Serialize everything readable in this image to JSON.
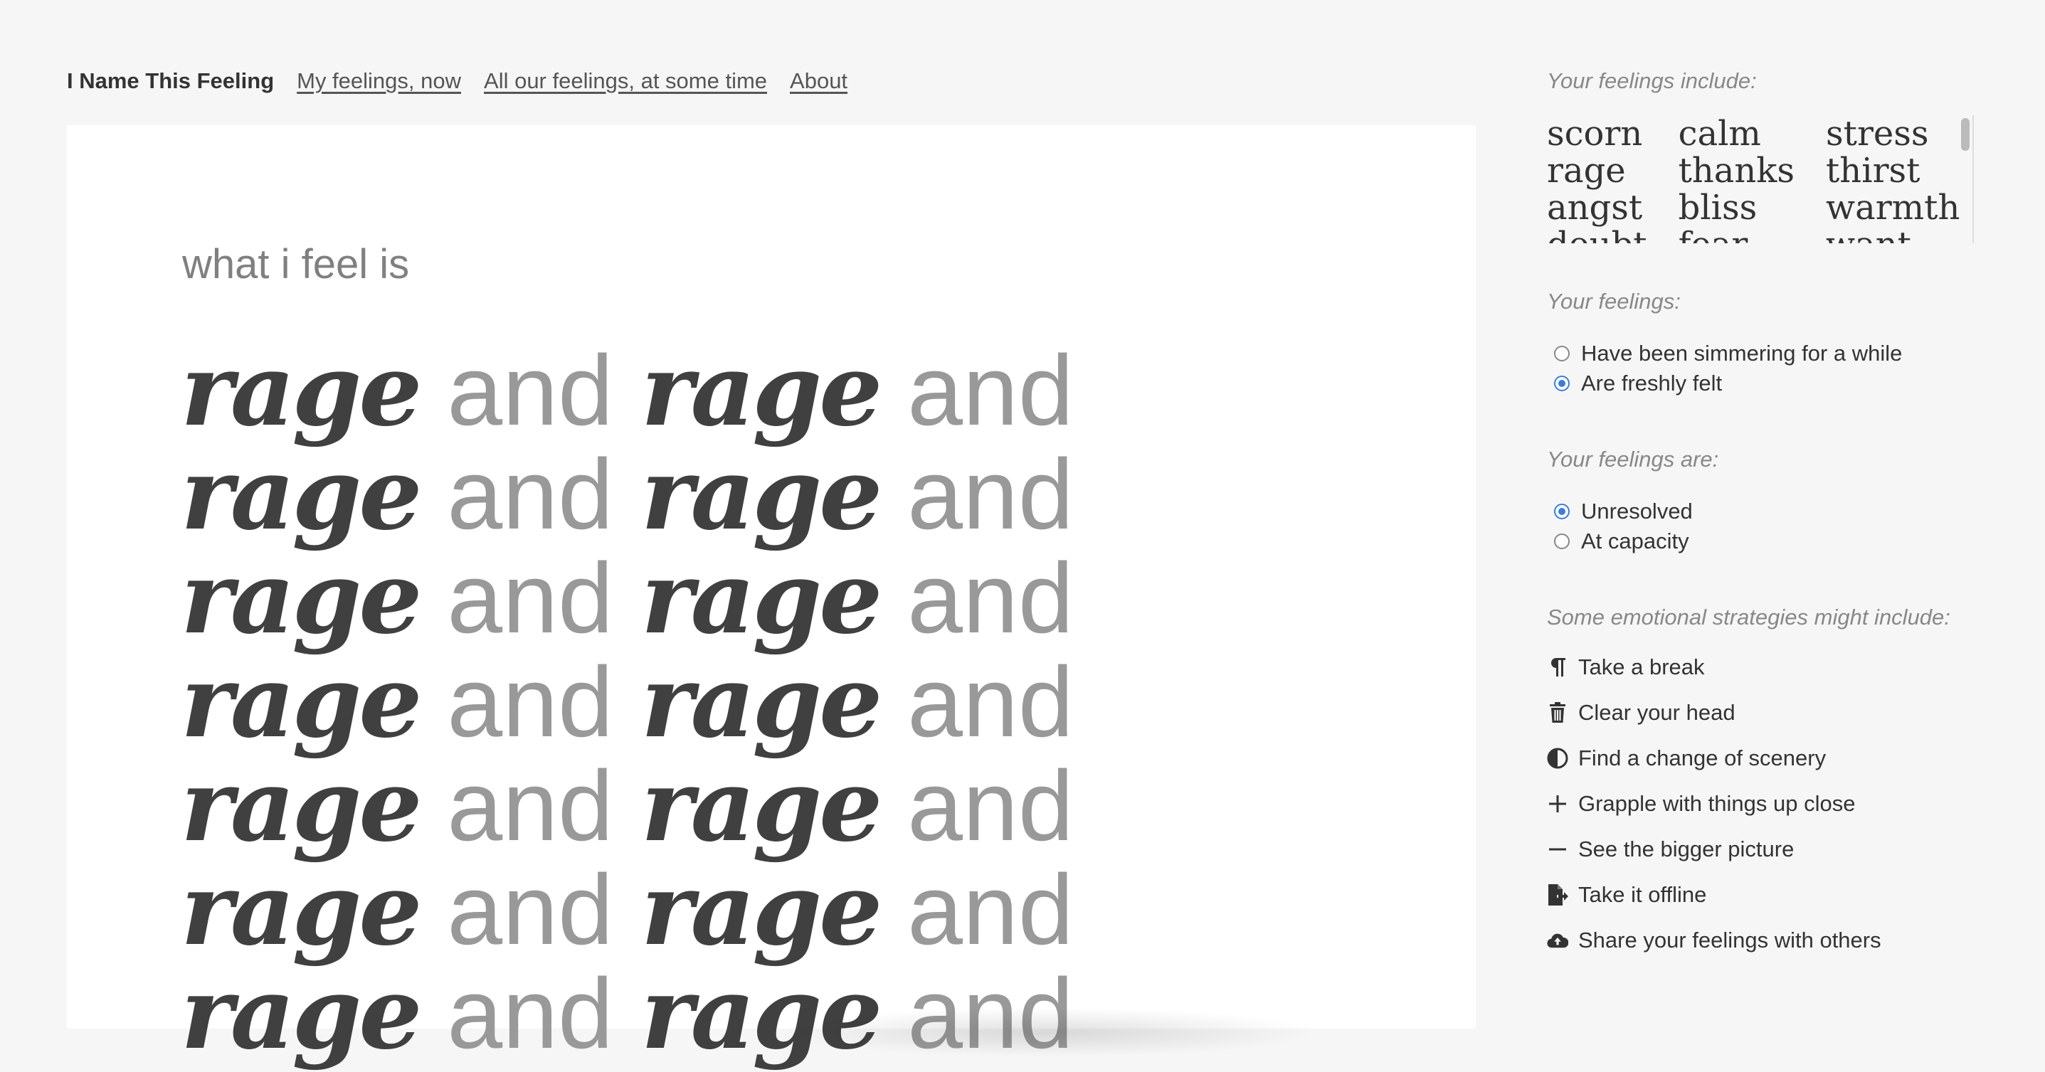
{
  "nav": {
    "brand": "I Name This Feeling",
    "links": [
      "My feelings, now",
      "All our feelings, at some time",
      "About"
    ]
  },
  "main": {
    "lead": "what i feel is",
    "feeling": "rage",
    "connector": "and",
    "repeat_count": 14
  },
  "sidebar": {
    "feelings_heading": "Your feelings include:",
    "feelings": [
      "scorn",
      "calm",
      "stress",
      "rage",
      "thanks",
      "thirst",
      "angst",
      "bliss",
      "warmth",
      "doubt",
      "fear",
      "want"
    ],
    "timing_heading": "Your feelings:",
    "timing_options": [
      {
        "label": "Have been simmering for a while",
        "checked": false
      },
      {
        "label": "Are freshly felt",
        "checked": true
      }
    ],
    "state_heading": "Your feelings are:",
    "state_options": [
      {
        "label": "Unresolved",
        "checked": true
      },
      {
        "label": "At capacity",
        "checked": false
      }
    ],
    "strategies_heading": "Some emotional strategies might include:",
    "strategies": [
      {
        "label": "Take a break",
        "icon": "pilcrow-icon"
      },
      {
        "label": "Clear your head",
        "icon": "trash-icon"
      },
      {
        "label": "Find a change of scenery",
        "icon": "contrast-icon"
      },
      {
        "label": "Grapple with things up close",
        "icon": "plus-icon"
      },
      {
        "label": "See the bigger picture",
        "icon": "minus-icon"
      },
      {
        "label": "Take it offline",
        "icon": "file-export-icon"
      },
      {
        "label": "Share your feelings with others",
        "icon": "cloud-upload-icon"
      }
    ],
    "accent_color": "#3b7ddd"
  }
}
